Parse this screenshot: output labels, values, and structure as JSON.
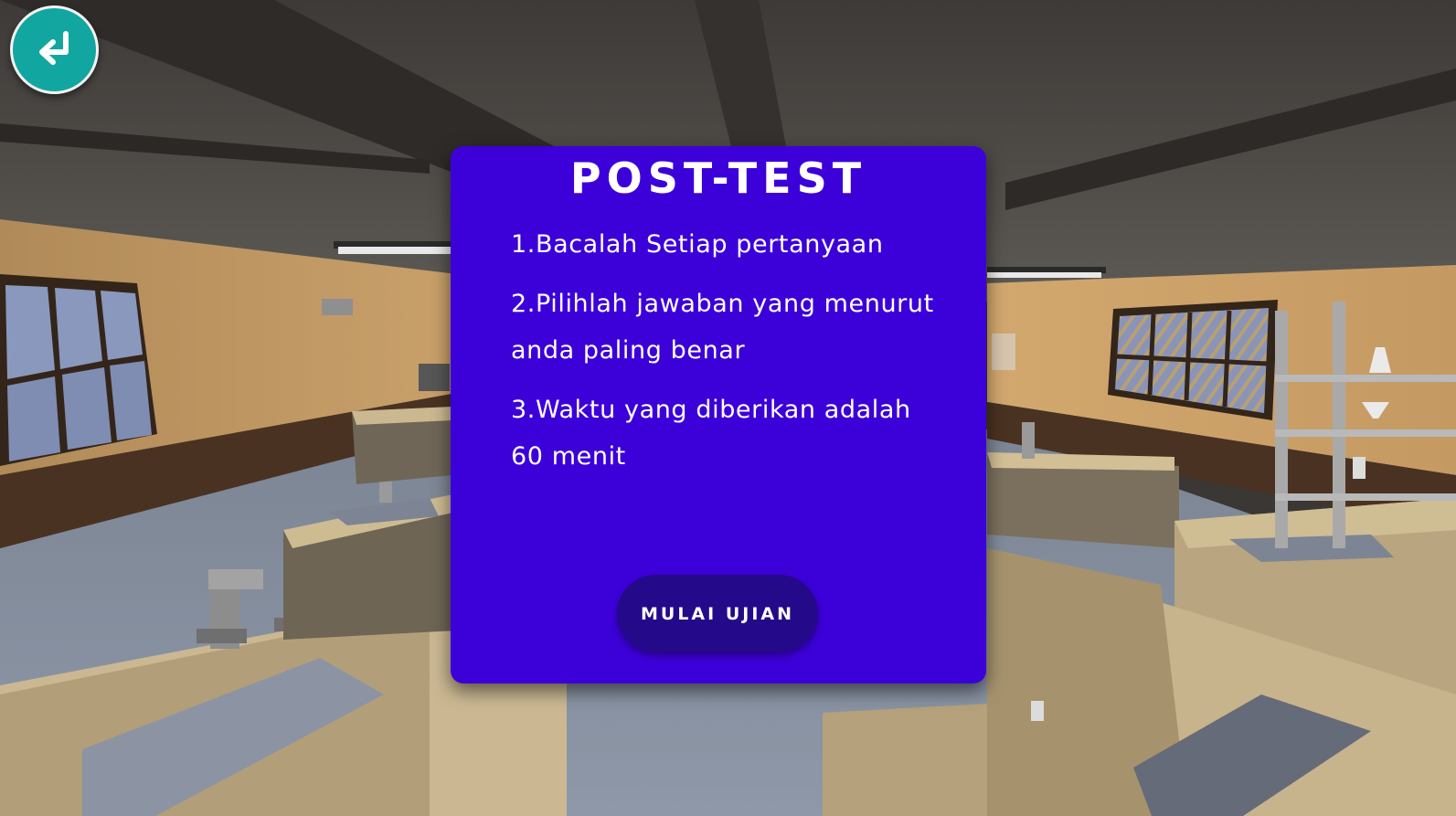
{
  "post_test": {
    "title": "POST-TEST",
    "rules": [
      "1.Bacalah Setiap pertanyaan",
      "2.Pilihlah jawaban yang menurut anda paling benar",
      "3.Waktu yang diberikan adalah 60 menit"
    ],
    "start_label": "MULAI UJIAN"
  },
  "icons": {
    "back": "return-arrow-icon"
  },
  "colors": {
    "panel": "#3c00d9",
    "start_button": "#240a8a",
    "back_button": "#12a6a0"
  }
}
